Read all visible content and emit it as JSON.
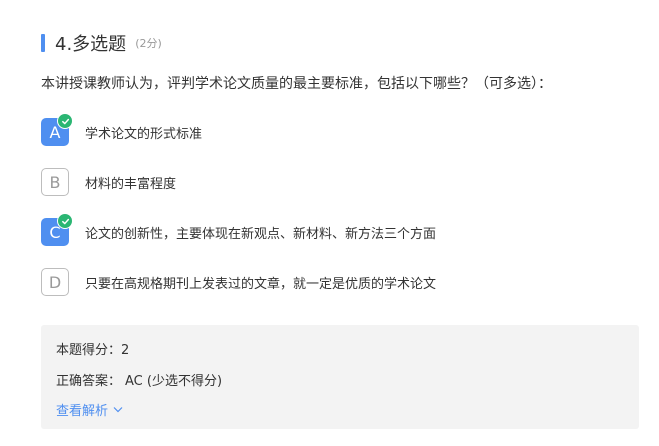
{
  "question": {
    "number_label": "4.多选题",
    "score_label": "(2分)",
    "stem": "本讲授课教师认为，评判学术论文质量的最主要标准，包括以下哪些？（可多选）："
  },
  "options": [
    {
      "letter": "A",
      "text": "学术论文的形式标准",
      "selected": true
    },
    {
      "letter": "B",
      "text": "材料的丰富程度",
      "selected": false
    },
    {
      "letter": "C",
      "text": "论文的创新性，主要体现在新观点、新材料、新方法三个方面",
      "selected": true
    },
    {
      "letter": "D",
      "text": "只要在高规格期刊上发表过的文章，就一定是优质的学术论文",
      "selected": false
    }
  ],
  "result": {
    "score_label": "本题得分：",
    "score_value": "2",
    "answer_label": "正确答案：",
    "answer_value": "AC (少选不得分)",
    "view_analysis": "查看解析"
  },
  "colors": {
    "accent": "#4f8ff0",
    "check": "#2bb673",
    "panel": "#f3f3f3"
  }
}
